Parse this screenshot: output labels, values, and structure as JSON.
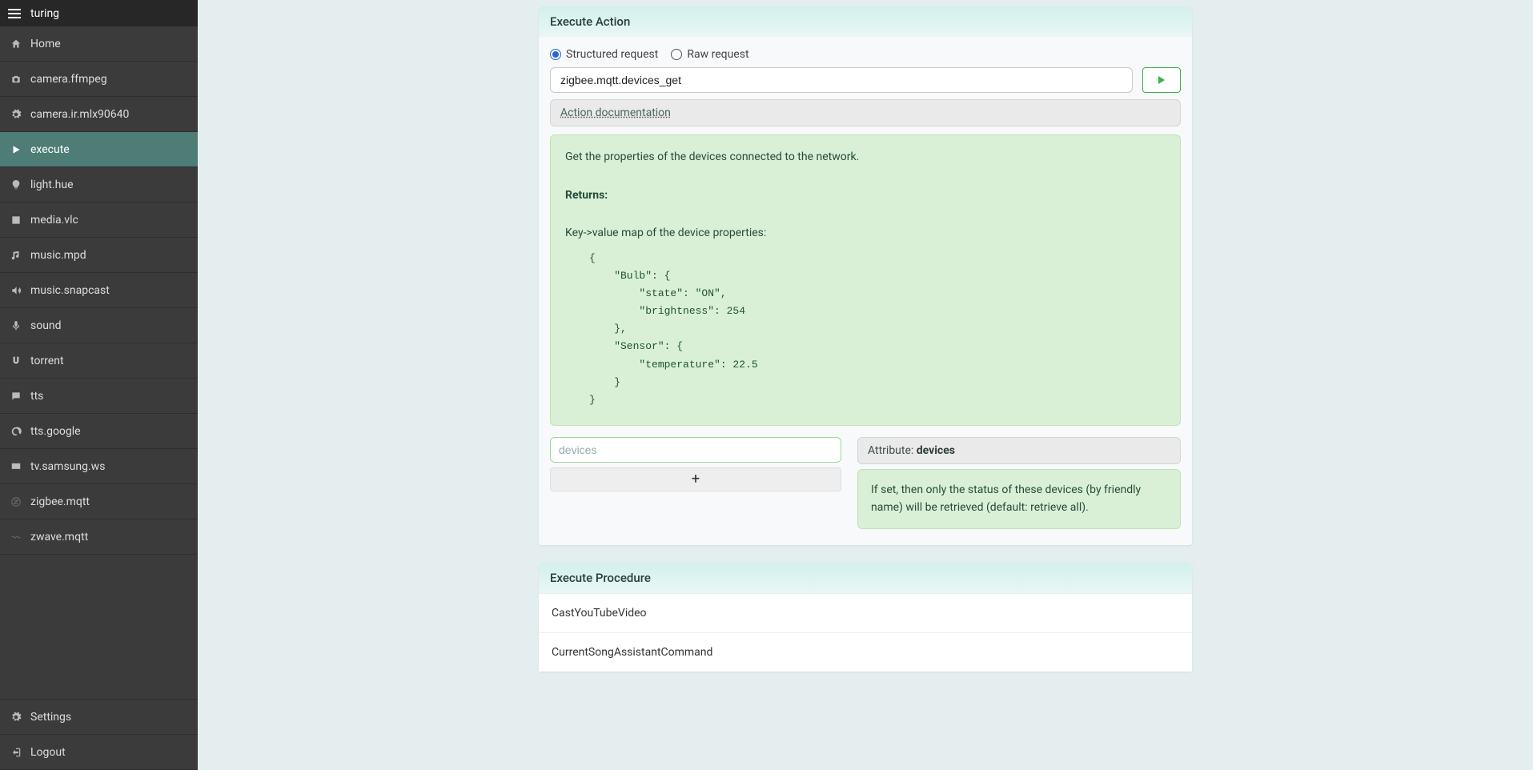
{
  "sidebar": {
    "title": "turing",
    "items": [
      {
        "label": "Home",
        "icon": "home"
      },
      {
        "label": "camera.ffmpeg",
        "icon": "camera"
      },
      {
        "label": "camera.ir.mlx90640",
        "icon": "gear"
      },
      {
        "label": "execute",
        "icon": "play",
        "active": true
      },
      {
        "label": "light.hue",
        "icon": "bulb"
      },
      {
        "label": "media.vlc",
        "icon": "film"
      },
      {
        "label": "music.mpd",
        "icon": "music"
      },
      {
        "label": "music.snapcast",
        "icon": "volume"
      },
      {
        "label": "sound",
        "icon": "mic"
      },
      {
        "label": "torrent",
        "icon": "magnet"
      },
      {
        "label": "tts",
        "icon": "chat"
      },
      {
        "label": "tts.google",
        "icon": "speech"
      },
      {
        "label": "tv.samsung.ws",
        "icon": "tv"
      },
      {
        "label": "zigbee.mqtt",
        "icon": "zigbee",
        "faded": true
      },
      {
        "label": "zwave.mqtt",
        "icon": "wave",
        "faded": true
      }
    ],
    "footer": [
      {
        "label": "Settings",
        "icon": "gear"
      },
      {
        "label": "Logout",
        "icon": "logout"
      }
    ]
  },
  "execute": {
    "title": "Execute Action",
    "request_types": {
      "structured": "Structured request",
      "raw": "Raw request"
    },
    "selected_request_type": "structured",
    "action_value": "zigbee.mqtt.devices_get",
    "doc_link": "Action documentation",
    "doc": {
      "intro": "Get the properties of the devices connected to the network.",
      "returns_label": "Returns:",
      "returns_desc": "Key->value map of the device properties:",
      "returns_example": "{\n    \"Bulb\": {\n        \"state\": \"ON\",\n        \"brightness\": 254\n    },\n    \"Sensor\": {\n        \"temperature\": 22.5\n    }\n}"
    },
    "attr": {
      "placeholder": "devices",
      "value": "",
      "add_label": "+",
      "name_prefix": "Attribute: ",
      "name": "devices",
      "desc": "If set, then only the status of these devices (by friendly name) will be retrieved (default: retrieve all)."
    }
  },
  "procedures": {
    "title": "Execute Procedure",
    "items": [
      "CastYouTubeVideo",
      "CurrentSongAssistantCommand"
    ]
  }
}
